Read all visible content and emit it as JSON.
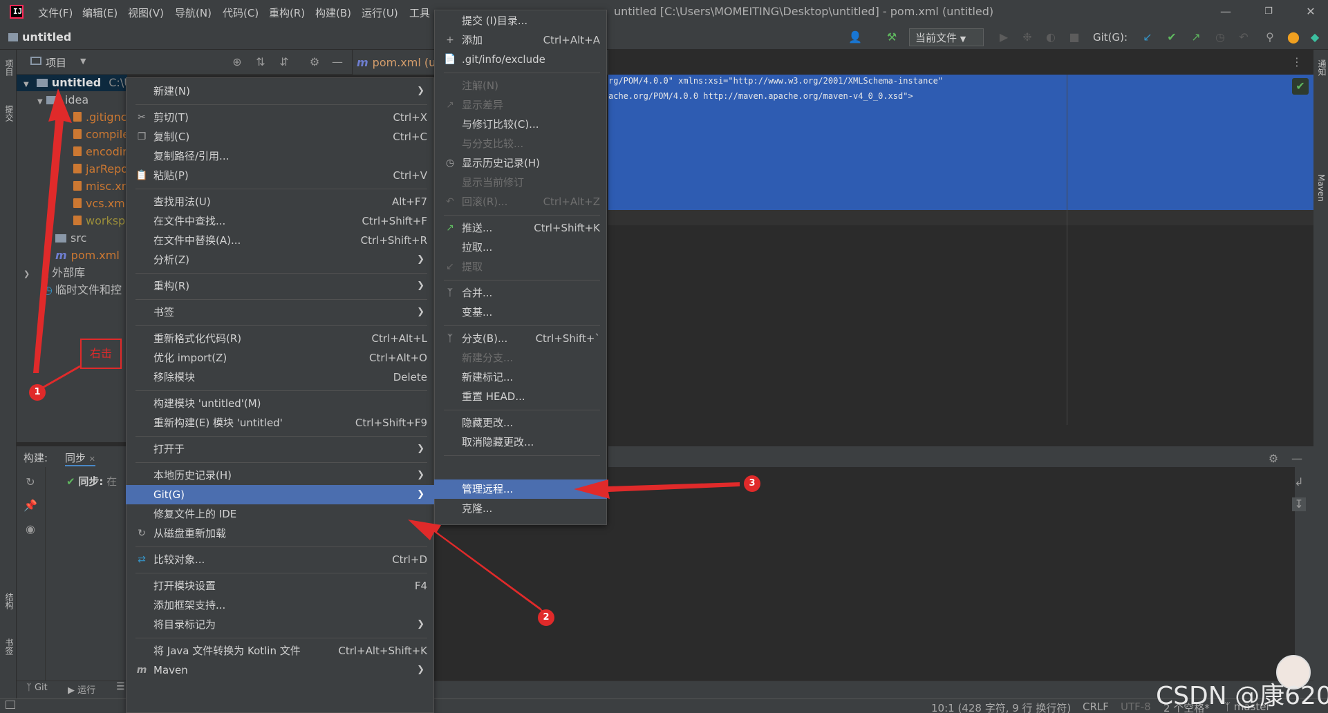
{
  "titlebar": {
    "menu": [
      "文件(F)",
      "编辑(E)",
      "视图(V)",
      "导航(N)",
      "代码(C)",
      "重构(R)",
      "构建(B)",
      "运行(U)",
      "工具"
    ],
    "window_title": "untitled [C:\\Users\\MOMEITING\\Desktop\\untitled] - pom.xml (untitled)"
  },
  "toolbar": {
    "project_name": "untitled",
    "run_config": "当前文件",
    "git_label": "Git(G):"
  },
  "project_panel": {
    "title": "项目",
    "tree": [
      {
        "label": "untitled",
        "suffix": "C:\\U"
      },
      {
        "label": ".idea"
      },
      {
        "label": ".gitignc"
      },
      {
        "label": "compile"
      },
      {
        "label": "encodir"
      },
      {
        "label": "jarRepo"
      },
      {
        "label": "misc.xn"
      },
      {
        "label": "vcs.xml"
      },
      {
        "label": "worksp"
      },
      {
        "label": "src"
      },
      {
        "label": "pom.xml"
      },
      {
        "label": "外部库"
      },
      {
        "label": "临时文件和控"
      }
    ]
  },
  "editor": {
    "tab_label": "pom.xml (u",
    "code_lines": [
      "rg/POM/4.0.0\" xmlns:xsi=\"http://www.w3.org/2001/XMLSchema-instance\"",
      "ache.org/POM/4.0.0 http://maven.apache.org/maven-v4_0_0.xsd\">"
    ]
  },
  "build_panel": {
    "title": "构建:",
    "tab": "同步",
    "sync_item": "同步:",
    "sync_suffix": "在"
  },
  "side_labels": {
    "left_top": "项目",
    "left_commit": "提交",
    "left_structure": "结构",
    "left_bookmarks": "书签",
    "right_notifications": "通知",
    "right_maven": "Maven"
  },
  "context_menu": {
    "items": [
      {
        "label": "新建(N)",
        "shortcut": "",
        "submenu": true
      },
      {
        "label": "剪切(T)",
        "shortcut": "Ctrl+X",
        "icon": "scissors-icon"
      },
      {
        "label": "复制(C)",
        "shortcut": "Ctrl+C",
        "icon": "copy-icon"
      },
      {
        "label": "复制路径/引用...",
        "shortcut": ""
      },
      {
        "label": "粘贴(P)",
        "shortcut": "Ctrl+V",
        "icon": "paste-icon"
      },
      {
        "label": "查找用法(U)",
        "shortcut": "Alt+F7"
      },
      {
        "label": "在文件中查找...",
        "shortcut": "Ctrl+Shift+F"
      },
      {
        "label": "在文件中替换(A)...",
        "shortcut": "Ctrl+Shift+R"
      },
      {
        "label": "分析(Z)",
        "shortcut": "",
        "submenu": true
      },
      {
        "label": "重构(R)",
        "shortcut": "",
        "submenu": true
      },
      {
        "label": "书签",
        "shortcut": "",
        "submenu": true
      },
      {
        "label": "重新格式化代码(R)",
        "shortcut": "Ctrl+Alt+L"
      },
      {
        "label": "优化 import(Z)",
        "shortcut": "Ctrl+Alt+O"
      },
      {
        "label": "移除模块",
        "shortcut": "Delete"
      },
      {
        "label": "构建模块 'untitled'(M)",
        "shortcut": ""
      },
      {
        "label": "重新构建(E) 模块 'untitled'",
        "shortcut": "Ctrl+Shift+F9"
      },
      {
        "label": "打开于",
        "shortcut": "",
        "submenu": true
      },
      {
        "label": "本地历史记录(H)",
        "shortcut": "",
        "submenu": true
      },
      {
        "label": "Git(G)",
        "shortcut": "",
        "submenu": true,
        "highlighted": true
      },
      {
        "label": "修复文件上的 IDE",
        "shortcut": ""
      },
      {
        "label": "从磁盘重新加载",
        "shortcut": "",
        "icon": "reload-icon"
      },
      {
        "label": "比较对象...",
        "shortcut": "Ctrl+D",
        "icon": "compare-icon"
      },
      {
        "label": "打开模块设置",
        "shortcut": "F4"
      },
      {
        "label": "添加框架支持...",
        "shortcut": ""
      },
      {
        "label": "将目录标记为",
        "shortcut": "",
        "submenu": true
      },
      {
        "label": "将 Java 文件转换为 Kotlin 文件",
        "shortcut": "Ctrl+Alt+Shift+K"
      },
      {
        "label": "Maven",
        "shortcut": "",
        "submenu": true,
        "icon": "maven-icon"
      }
    ]
  },
  "git_submenu": {
    "items": [
      {
        "label": "提交 (I)目录...",
        "shortcut": ""
      },
      {
        "label": "添加",
        "shortcut": "Ctrl+Alt+A",
        "icon": "plus-icon"
      },
      {
        "label": ".git/info/exclude",
        "shortcut": "",
        "icon": "git-file-icon"
      },
      {
        "label": "注解(N)",
        "shortcut": "",
        "disabled": true
      },
      {
        "label": "显示差异",
        "shortcut": "",
        "disabled": true,
        "icon": "diff-icon"
      },
      {
        "label": "与修订比较(C)...",
        "shortcut": ""
      },
      {
        "label": "与分支比较...",
        "shortcut": "",
        "disabled": true
      },
      {
        "label": "显示历史记录(H)",
        "shortcut": "",
        "icon": "clock-icon"
      },
      {
        "label": "显示当前修订",
        "shortcut": "",
        "disabled": true
      },
      {
        "label": "回滚(R)...",
        "shortcut": "Ctrl+Alt+Z",
        "disabled": true,
        "icon": "rollback-icon"
      },
      {
        "label": "推送...",
        "shortcut": "Ctrl+Shift+K",
        "icon": "push-icon"
      },
      {
        "label": "拉取...",
        "shortcut": ""
      },
      {
        "label": "提取",
        "shortcut": "",
        "disabled": true,
        "icon": "fetch-icon"
      },
      {
        "label": "合并...",
        "shortcut": "",
        "icon": "merge-icon"
      },
      {
        "label": "变基...",
        "shortcut": ""
      },
      {
        "label": "分支(B)...",
        "shortcut": "Ctrl+Shift+`",
        "icon": "branch-icon"
      },
      {
        "label": "新建分支...",
        "shortcut": "",
        "disabled": true
      },
      {
        "label": "新建标记...",
        "shortcut": ""
      },
      {
        "label": "重置 HEAD...",
        "shortcut": ""
      },
      {
        "label": "隐藏更改...",
        "shortcut": ""
      },
      {
        "label": "取消隐藏更改...",
        "shortcut": ""
      },
      {
        "label": "管理远程...",
        "shortcut": "",
        "highlighted": true
      },
      {
        "label": "克隆...",
        "shortcut": ""
      }
    ]
  },
  "status_bar": {
    "position": "10:1 (428 字符, 9 行 换行符)",
    "line_sep": "CRLF",
    "encoding": "UTF-8",
    "indent": "2 个空格*",
    "branch": "master"
  },
  "tool_strip": {
    "git": "Git",
    "run": "运行"
  },
  "annotations": {
    "label_right_click": "右击",
    "step1": "1",
    "step2": "2",
    "step3": "3",
    "watermark": "CSDN @康620"
  },
  "colors": {
    "accent_highlight": "#4b6eaf",
    "annotation_red": "#e02a2a",
    "selection_blue": "#2f65ca"
  }
}
